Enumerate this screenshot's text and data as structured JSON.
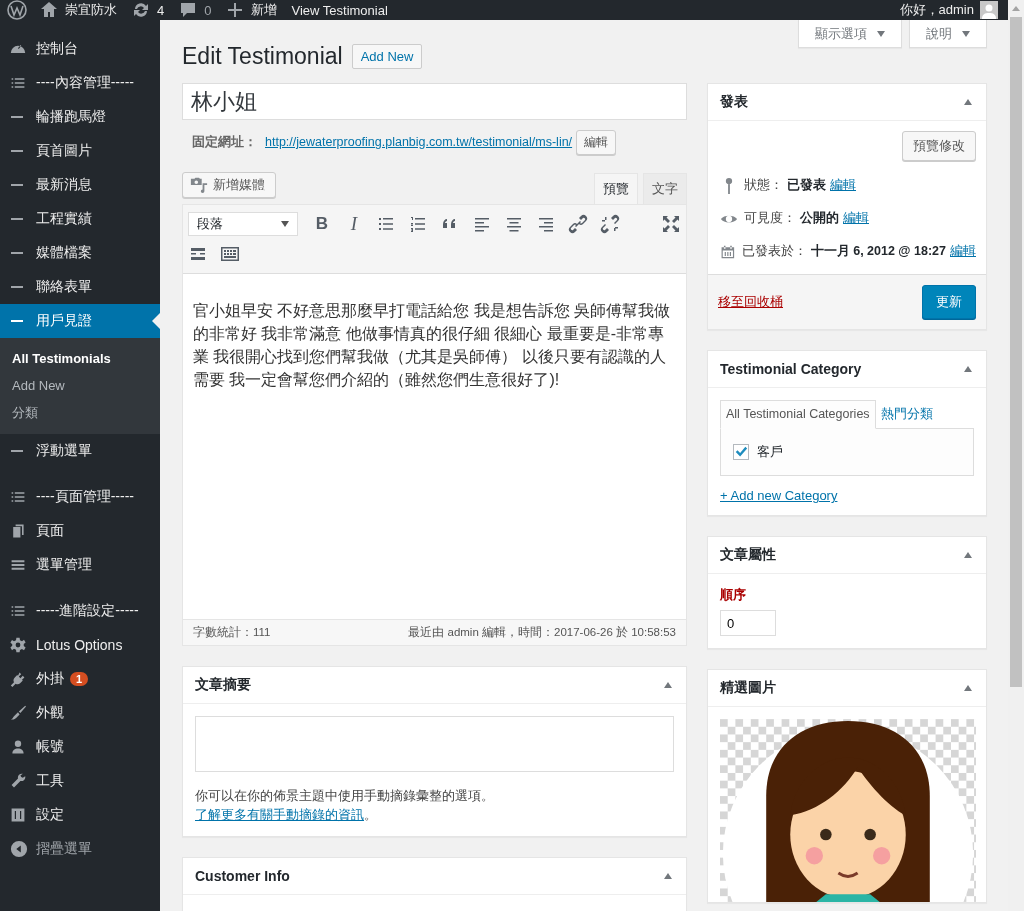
{
  "admin_bar": {
    "site": "崇宜防水",
    "updates": "4",
    "comments": "0",
    "new": "新增",
    "view": "View Testimonial",
    "greeting": "你好，admin"
  },
  "sidebar": {
    "items": [
      {
        "label": "控制台",
        "kind": "menu",
        "selected": false
      },
      {
        "label": "----內容管理-----",
        "kind": "menu",
        "selected": false
      },
      {
        "label": "輪播跑馬燈",
        "kind": "menu",
        "selected": false
      },
      {
        "label": "頁首圖片",
        "kind": "menu",
        "selected": false
      },
      {
        "label": "最新消息",
        "kind": "menu",
        "selected": false
      },
      {
        "label": "工程實績",
        "kind": "menu",
        "selected": false
      },
      {
        "label": "媒體檔案",
        "kind": "menu",
        "selected": false
      },
      {
        "label": "聯絡表單",
        "kind": "menu",
        "selected": false
      },
      {
        "label": "用戶見證",
        "kind": "menu",
        "selected": true,
        "children": [
          {
            "label": "All Testimonials",
            "selected": true
          },
          {
            "label": "Add New",
            "selected": false
          },
          {
            "label": "分類",
            "selected": false
          }
        ]
      },
      {
        "label": "浮動選單",
        "kind": "menu",
        "selected": false
      },
      {
        "kind": "separator"
      },
      {
        "label": "----頁面管理-----",
        "kind": "menu",
        "selected": false
      },
      {
        "label": "頁面",
        "kind": "menu",
        "selected": false
      },
      {
        "label": "選單管理",
        "kind": "menu",
        "selected": false
      },
      {
        "kind": "separator"
      },
      {
        "label": "-----進階設定-----",
        "kind": "menu",
        "selected": false
      },
      {
        "label": "Lotus Options",
        "kind": "menu",
        "selected": false
      },
      {
        "label": "外掛",
        "kind": "menu",
        "selected": false,
        "badge": "1"
      },
      {
        "label": "外觀",
        "kind": "menu",
        "selected": false
      },
      {
        "label": "帳號",
        "kind": "menu",
        "selected": false
      },
      {
        "label": "工具",
        "kind": "menu",
        "selected": false
      },
      {
        "label": "設定",
        "kind": "menu",
        "selected": false
      },
      {
        "label": "摺疊選單",
        "kind": "collapse",
        "selected": false
      }
    ]
  },
  "screen_tabs": [
    "顯示選項",
    "說明"
  ],
  "page_title": "Edit Testimonial",
  "add_new": "Add New",
  "title_field": {
    "value": "林小姐"
  },
  "permalink": {
    "label": "固定網址：",
    "url": "http://jewaterproofing.planbig.com.tw/testimonial/ms-lin/",
    "edit": "編輯"
  },
  "editor": {
    "add_media": "新增媒體",
    "tabs": [
      {
        "label": "預覽",
        "selected": true
      },
      {
        "label": "文字",
        "selected": false
      }
    ],
    "format": "段落",
    "toolbar_glyphs": [
      "B",
      "I"
    ],
    "content": "官小姐早安 不好意思那麼早打電話給您 我是想告訴您 吳師傅幫我做的非常好 我非常滿意 他做事情真的很仔細 很細心 最重要是-非常專業 我很開心找到您們幫我做（尤其是吳師傅） 以後只要有認識的人需要 我一定會幫您們介紹的（雖然您們生意很好了)!",
    "word_count": "字數統計：111",
    "last_edit": "最近由 admin 編輯，時間：2017-06-26 於 10:58:53"
  },
  "excerpt": {
    "title": "文章摘要",
    "help": "你可以在你的佈景主題中使用手動摘錄彙整的選項。",
    "link": "了解更多有關手動摘錄的資訊",
    "after": "。"
  },
  "customer_info": {
    "title": "Customer Info"
  },
  "publish": {
    "title": "發表",
    "preview": "預覽修改",
    "rows": [
      {
        "label": "狀態：",
        "value": "已發表",
        "edit": "編輯"
      },
      {
        "label": "可見度：",
        "value": "公開的",
        "edit": "編輯"
      },
      {
        "label": "已發表於：",
        "value": "十一月 6, 2012 @ 18:27",
        "edit": "編輯"
      }
    ],
    "trash": "移至回收桶",
    "update": "更新"
  },
  "category": {
    "title": "Testimonial Category",
    "tabs": [
      {
        "label": "All Testimonial Categories",
        "selected": true
      },
      {
        "label": "熱門分類",
        "selected": false
      }
    ],
    "items": [
      {
        "label": "客戶",
        "checked": true
      }
    ],
    "add": "+ Add new Category"
  },
  "attributes": {
    "title": "文章屬性",
    "order_label": "順序",
    "order_value": "0"
  },
  "featured": {
    "title": "精選圖片"
  }
}
